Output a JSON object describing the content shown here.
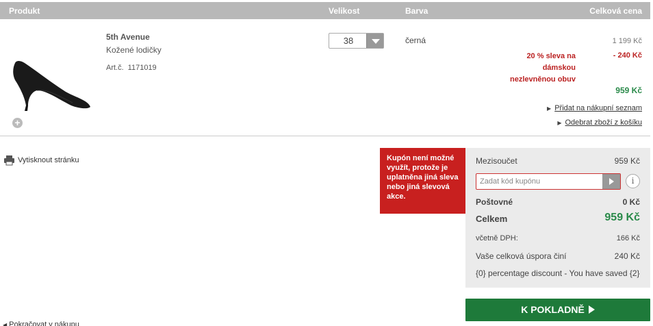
{
  "header": {
    "product": "Produkt",
    "size": "Velikost",
    "color": "Barva",
    "total": "Celková cena"
  },
  "item": {
    "brand": "5th Avenue",
    "name": "Kožené lodičky",
    "art_label": "Art.č.",
    "art_number": "1171019",
    "size": "38",
    "color": "černá",
    "price_original": "1 199 Kč",
    "discount_text": "20 % sleva na dámskou nezlevněnou obuv",
    "discount_value": "- 240 Kč",
    "price_final": "959 Kč",
    "add_wishlist": "Přidat na nákupní seznam",
    "remove_item": "Odebrat zboží z košíku",
    "zoom_icon": "plus-icon"
  },
  "print": {
    "label": "Vytisknout stránku",
    "icon": "printer-icon"
  },
  "tooltip": "Kupón není možné využít, protože je uplatněna jiná sleva nebo jiná slevová akce.",
  "summary": {
    "subtotal_label": "Mezisoučet",
    "subtotal": "959 Kč",
    "coupon_placeholder": "Zadat kód kupónu",
    "info_icon": "i",
    "shipping_label": "Poštovné",
    "shipping": "0 Kč",
    "total_label": "Celkem",
    "total": "959 Kč",
    "vat_label": "včetně DPH:",
    "vat": "166 Kč",
    "savings_label": "Vaše celková úspora činí",
    "savings": "240 Kč",
    "percentage_note": "{0} percentage discount - You have saved {2}"
  },
  "checkout": {
    "label": "K POKLADNĚ"
  },
  "back_link": "Pokračovat v nákupu",
  "colors": {
    "header_bg": "#b8b8b8",
    "discount_red": "#c8201f",
    "price_green": "#2a8a4a",
    "checkout_green": "#1e7a3a"
  }
}
